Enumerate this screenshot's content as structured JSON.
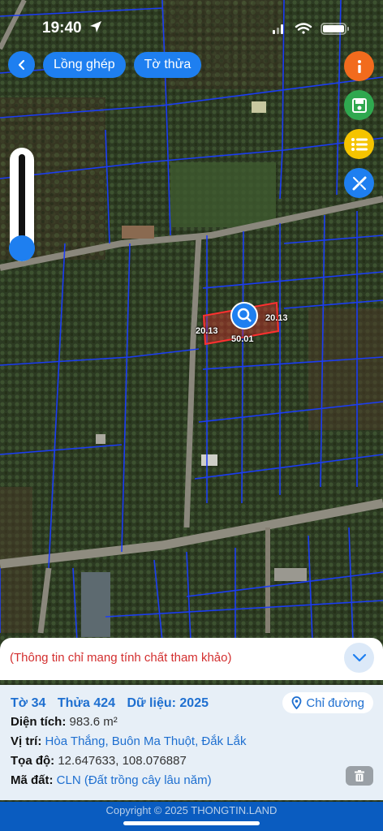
{
  "status": {
    "time": "19:40"
  },
  "topbar": {
    "back_icon": "chevron-left-icon",
    "overlay_label": "Lồng ghép",
    "sheet_label": "Tờ thửa"
  },
  "fabs": [
    {
      "name": "info-button",
      "icon": "info-icon",
      "color": "#f26b1d"
    },
    {
      "name": "save-button",
      "icon": "floppy-disk-icon",
      "color": "#2fa84f"
    },
    {
      "name": "list-button",
      "icon": "list-icon",
      "color": "#f5c400"
    },
    {
      "name": "measure-button",
      "icon": "ruler-pencil-icon",
      "color": "#1e7ff0"
    }
  ],
  "plot": {
    "left_edge": "20.13",
    "right_edge": "20.13",
    "bottom_edge": "50.01"
  },
  "notice": {
    "text": "(Thông tin chỉ mang tính chất tham khảo)"
  },
  "info": {
    "sheet_label": "Tờ 34",
    "parcel_label": "Thửa 424",
    "data_label": "Dữ liệu: 2025",
    "directions_label": "Chỉ đường",
    "area_key": "Diện tích:",
    "area_value": "983.6 m²",
    "location_key": "Vị trí:",
    "location_value": "Hòa Thắng, Buôn Ma Thuột, Đắk Lắk",
    "coords_key": "Tọa độ:",
    "coords_value": "12.647633, 108.076887",
    "landcode_key": "Mã đất:",
    "landcode_value": "CLN (Đất trồng cây lâu năm)"
  },
  "footer": {
    "copyright": "Copyright © 2025 THONGTIN.LAND"
  },
  "colors": {
    "accent": "#1e7ff0",
    "plot_outline": "#ff3030",
    "parcel_lines": "#1a3cff"
  }
}
